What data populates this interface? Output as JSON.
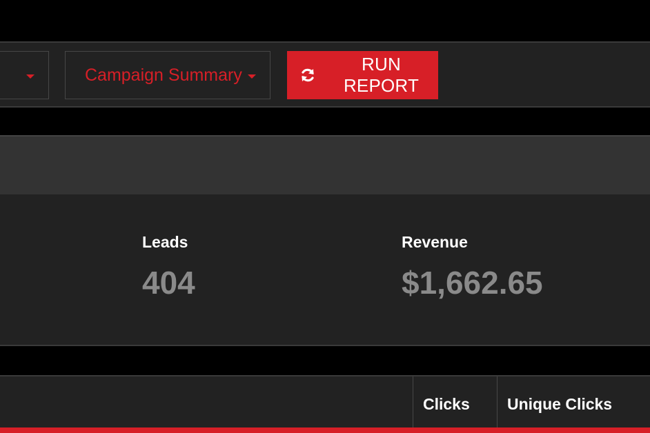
{
  "toolbar": {
    "first_dropdown": {
      "icon": "caret-down"
    },
    "report_dropdown": {
      "label": "Campaign Summary",
      "icon": "caret-down"
    },
    "run_button": {
      "label": "RUN REPORT",
      "icon": "refresh"
    }
  },
  "stats": {
    "leads": {
      "label": "Leads",
      "value": "404"
    },
    "revenue": {
      "label": "Revenue",
      "value": "$1,662.65"
    }
  },
  "table": {
    "columns": [
      "Clicks",
      "Unique Clicks"
    ]
  },
  "colors": {
    "accent": "#d71f27",
    "background": "#000000",
    "panel": "#222222",
    "panel_header": "#333333",
    "muted_value": "#8a8a8a"
  }
}
